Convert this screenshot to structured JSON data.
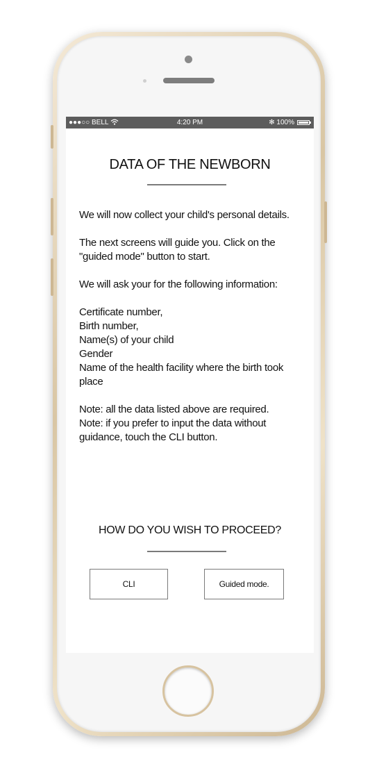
{
  "status_bar": {
    "signal": "●●●○○",
    "carrier": "BELL",
    "wifi_icon": "wifi-icon",
    "time": "4:20 PM",
    "bluetooth": "✻",
    "battery_percent": "100%",
    "battery_level": 1.0
  },
  "screen": {
    "title": "DATA OF THE NEWBORN",
    "paragraphs": [
      "We will now collect your child's personal details.",
      "The next screens will guide you. Click on the \"guided mode\" button to start.",
      "We will ask your for the following information:"
    ],
    "fields": [
      "Certificate number,",
      "Birth number,",
      "Name(s) of your child",
      "Gender",
      "Name of the health facility where the birth took place"
    ],
    "notes": [
      "Note: all the data listed above are required.",
      "Note: if you prefer to input the data without guidance, touch the CLI button."
    ],
    "proceed_question": "HOW DO YOU WISH TO PROCEED?",
    "buttons": {
      "cli": "CLI",
      "guided": "Guided mode."
    }
  },
  "colors": {
    "status_bar": "#5c5c5c",
    "phone_frame": "#d9c6a4",
    "divider": "#7a7a7a"
  }
}
